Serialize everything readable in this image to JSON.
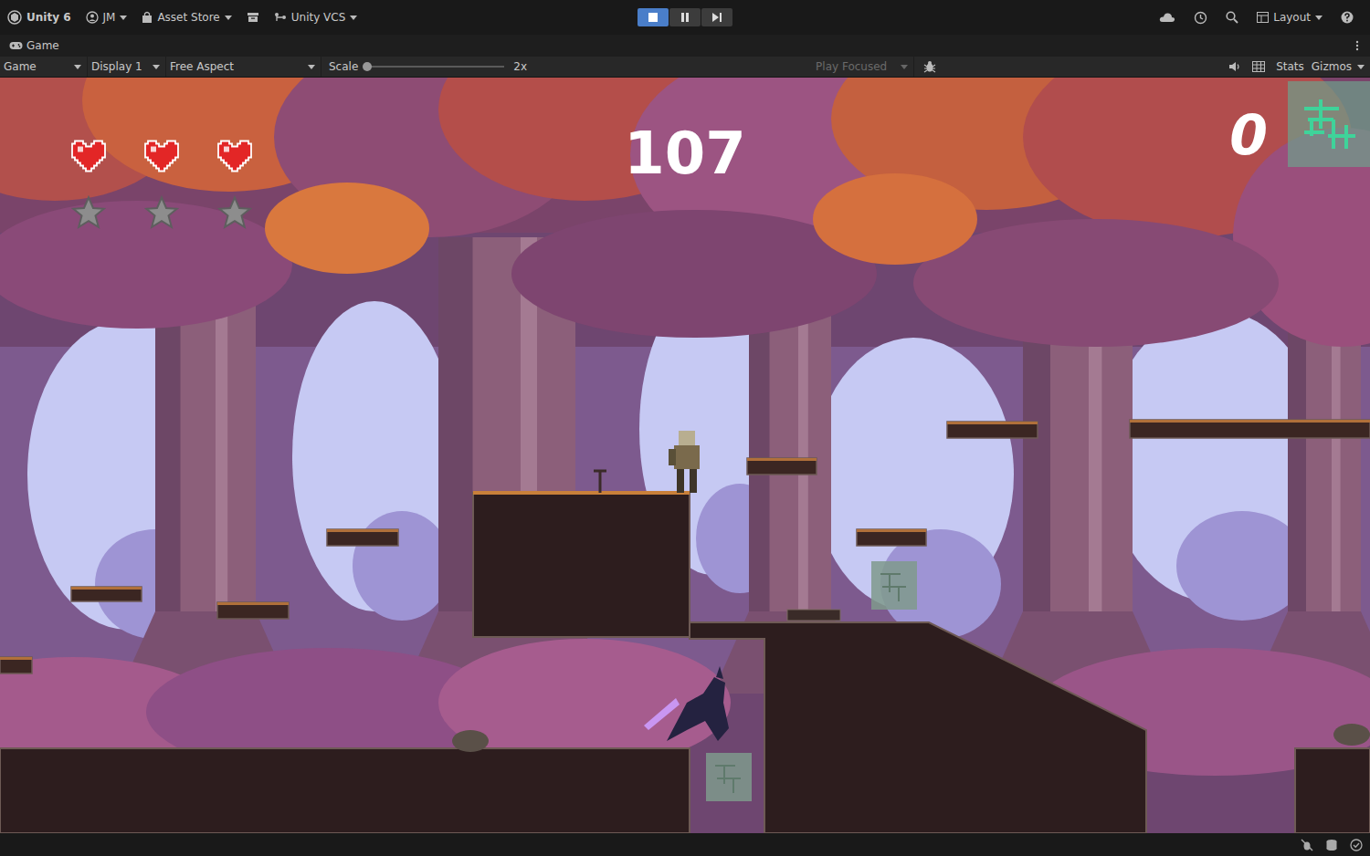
{
  "toolbar": {
    "product": "Unity 6",
    "account": "JM",
    "asset_store": "Asset Store",
    "vcs": "Unity VCS",
    "layout": "Layout",
    "play_controls": [
      {
        "kind": "play",
        "selected": true
      },
      {
        "kind": "pause",
        "selected": false
      },
      {
        "kind": "step",
        "selected": false
      }
    ]
  },
  "panel_tab": {
    "label": "Game"
  },
  "game_bar": {
    "view_mode": "Game",
    "display": "Display 1",
    "aspect": "Free Aspect",
    "scale_label": "Scale",
    "scale": {
      "level": 0
    },
    "scale_reading": "2x",
    "play_mode": {
      "label": "Play Focused",
      "disabled": true
    },
    "stats": "Stats",
    "gizmos": "Gizmos"
  },
  "hud": {
    "hearts": [
      {
        "full": true
      },
      {
        "full": true
      },
      {
        "full": true
      }
    ],
    "stars": {
      "stars": 0,
      "max": 3
    },
    "timer": "107",
    "score": "0"
  }
}
